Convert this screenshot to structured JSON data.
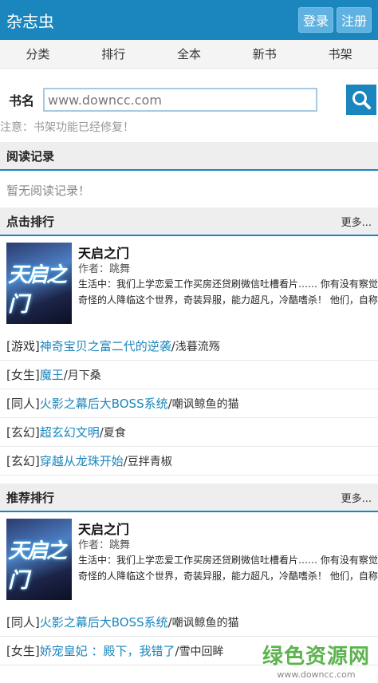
{
  "header": {
    "title": "杂志虫",
    "login": "登录",
    "register": "注册"
  },
  "nav": [
    "分类",
    "排行",
    "全本",
    "新书",
    "书架"
  ],
  "search": {
    "label": "书名",
    "value": "www.downcc.com"
  },
  "notice": "注意：书架功能已经修复！",
  "reading": {
    "title": "阅读记录",
    "empty": "暂无阅读记录！"
  },
  "click_rank": {
    "title": "点击排行",
    "more": "更多...",
    "feature": {
      "cover_text": "天启之门",
      "title": "天启之门",
      "author": "作者：跳舞",
      "desc": "生活中：我们上学恋爱工作买房还贷刷微信吐槽看片…… 你有没有察觉这个世界其实哪里不对？ 忽然一天，一群奇怪的人降临这个世界，奇装异服，能力超凡，冷酷嗜杀！ 他们，自称为"
    },
    "items": [
      {
        "cat": "[游戏]",
        "title": "神奇宝贝之富二代的逆袭",
        "author": "浅暮流殇"
      },
      {
        "cat": "[女生]",
        "title": "魔王",
        "author": "月下桑"
      },
      {
        "cat": "[同人]",
        "title": "火影之幕后大BOSS系统",
        "author": "嘲讽鲸鱼的猫"
      },
      {
        "cat": "[玄幻]",
        "title": "超玄幻文明",
        "author": "夏食"
      },
      {
        "cat": "[玄幻]",
        "title": "穿越从龙珠开始",
        "author": "豆拌青椒"
      }
    ]
  },
  "recommend_rank": {
    "title": "推荐排行",
    "more": "更多...",
    "feature": {
      "cover_text": "天启之门",
      "title": "天启之门",
      "author": "作者：跳舞",
      "desc": "生活中：我们上学恋爱工作买房还贷刷微信吐槽看片…… 你有没有察觉这个世界其实哪里不对？ 忽然一天，一群奇怪的人降临这个世界，奇装异服，能力超凡，冷酷嗜杀！ 他们，自称为"
    },
    "items": [
      {
        "cat": "[同人]",
        "title": "火影之幕后大BOSS系统",
        "author": "嘲讽鲸鱼的猫"
      },
      {
        "cat": "[女生]",
        "title": "娇宠皇妃 ：殿下，我错了",
        "author": "雪中回眸"
      }
    ]
  },
  "watermark": {
    "cn": "绿色资源网",
    "url": "www.downcc.com"
  },
  "colors": {
    "primary": "#1a86bd",
    "link": "#1a86bd",
    "section_bg": "#eeeeee",
    "watermark": "#5db34f"
  }
}
